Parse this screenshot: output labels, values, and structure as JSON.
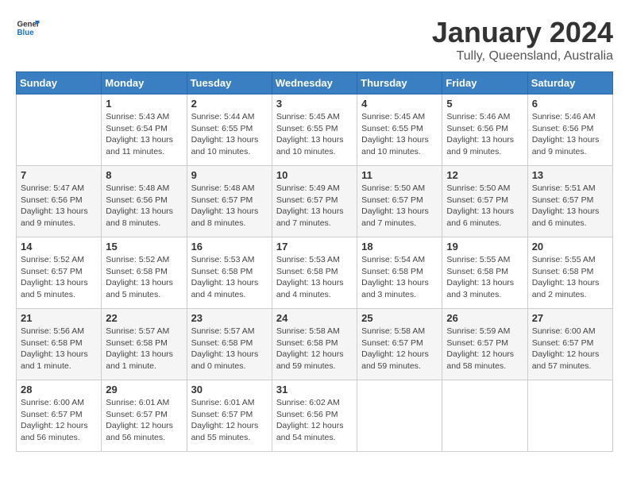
{
  "header": {
    "logo_general": "General",
    "logo_blue": "Blue",
    "month_title": "January 2024",
    "location": "Tully, Queensland, Australia"
  },
  "weekdays": [
    "Sunday",
    "Monday",
    "Tuesday",
    "Wednesday",
    "Thursday",
    "Friday",
    "Saturday"
  ],
  "weeks": [
    [
      {
        "day": "",
        "sunrise": "",
        "sunset": "",
        "daylight": ""
      },
      {
        "day": "1",
        "sunrise": "Sunrise: 5:43 AM",
        "sunset": "Sunset: 6:54 PM",
        "daylight": "Daylight: 13 hours and 11 minutes."
      },
      {
        "day": "2",
        "sunrise": "Sunrise: 5:44 AM",
        "sunset": "Sunset: 6:55 PM",
        "daylight": "Daylight: 13 hours and 10 minutes."
      },
      {
        "day": "3",
        "sunrise": "Sunrise: 5:45 AM",
        "sunset": "Sunset: 6:55 PM",
        "daylight": "Daylight: 13 hours and 10 minutes."
      },
      {
        "day": "4",
        "sunrise": "Sunrise: 5:45 AM",
        "sunset": "Sunset: 6:55 PM",
        "daylight": "Daylight: 13 hours and 10 minutes."
      },
      {
        "day": "5",
        "sunrise": "Sunrise: 5:46 AM",
        "sunset": "Sunset: 6:56 PM",
        "daylight": "Daylight: 13 hours and 9 minutes."
      },
      {
        "day": "6",
        "sunrise": "Sunrise: 5:46 AM",
        "sunset": "Sunset: 6:56 PM",
        "daylight": "Daylight: 13 hours and 9 minutes."
      }
    ],
    [
      {
        "day": "7",
        "sunrise": "Sunrise: 5:47 AM",
        "sunset": "Sunset: 6:56 PM",
        "daylight": "Daylight: 13 hours and 9 minutes."
      },
      {
        "day": "8",
        "sunrise": "Sunrise: 5:48 AM",
        "sunset": "Sunset: 6:56 PM",
        "daylight": "Daylight: 13 hours and 8 minutes."
      },
      {
        "day": "9",
        "sunrise": "Sunrise: 5:48 AM",
        "sunset": "Sunset: 6:57 PM",
        "daylight": "Daylight: 13 hours and 8 minutes."
      },
      {
        "day": "10",
        "sunrise": "Sunrise: 5:49 AM",
        "sunset": "Sunset: 6:57 PM",
        "daylight": "Daylight: 13 hours and 7 minutes."
      },
      {
        "day": "11",
        "sunrise": "Sunrise: 5:50 AM",
        "sunset": "Sunset: 6:57 PM",
        "daylight": "Daylight: 13 hours and 7 minutes."
      },
      {
        "day": "12",
        "sunrise": "Sunrise: 5:50 AM",
        "sunset": "Sunset: 6:57 PM",
        "daylight": "Daylight: 13 hours and 6 minutes."
      },
      {
        "day": "13",
        "sunrise": "Sunrise: 5:51 AM",
        "sunset": "Sunset: 6:57 PM",
        "daylight": "Daylight: 13 hours and 6 minutes."
      }
    ],
    [
      {
        "day": "14",
        "sunrise": "Sunrise: 5:52 AM",
        "sunset": "Sunset: 6:57 PM",
        "daylight": "Daylight: 13 hours and 5 minutes."
      },
      {
        "day": "15",
        "sunrise": "Sunrise: 5:52 AM",
        "sunset": "Sunset: 6:58 PM",
        "daylight": "Daylight: 13 hours and 5 minutes."
      },
      {
        "day": "16",
        "sunrise": "Sunrise: 5:53 AM",
        "sunset": "Sunset: 6:58 PM",
        "daylight": "Daylight: 13 hours and 4 minutes."
      },
      {
        "day": "17",
        "sunrise": "Sunrise: 5:53 AM",
        "sunset": "Sunset: 6:58 PM",
        "daylight": "Daylight: 13 hours and 4 minutes."
      },
      {
        "day": "18",
        "sunrise": "Sunrise: 5:54 AM",
        "sunset": "Sunset: 6:58 PM",
        "daylight": "Daylight: 13 hours and 3 minutes."
      },
      {
        "day": "19",
        "sunrise": "Sunrise: 5:55 AM",
        "sunset": "Sunset: 6:58 PM",
        "daylight": "Daylight: 13 hours and 3 minutes."
      },
      {
        "day": "20",
        "sunrise": "Sunrise: 5:55 AM",
        "sunset": "Sunset: 6:58 PM",
        "daylight": "Daylight: 13 hours and 2 minutes."
      }
    ],
    [
      {
        "day": "21",
        "sunrise": "Sunrise: 5:56 AM",
        "sunset": "Sunset: 6:58 PM",
        "daylight": "Daylight: 13 hours and 1 minute."
      },
      {
        "day": "22",
        "sunrise": "Sunrise: 5:57 AM",
        "sunset": "Sunset: 6:58 PM",
        "daylight": "Daylight: 13 hours and 1 minute."
      },
      {
        "day": "23",
        "sunrise": "Sunrise: 5:57 AM",
        "sunset": "Sunset: 6:58 PM",
        "daylight": "Daylight: 13 hours and 0 minutes."
      },
      {
        "day": "24",
        "sunrise": "Sunrise: 5:58 AM",
        "sunset": "Sunset: 6:58 PM",
        "daylight": "Daylight: 12 hours and 59 minutes."
      },
      {
        "day": "25",
        "sunrise": "Sunrise: 5:58 AM",
        "sunset": "Sunset: 6:57 PM",
        "daylight": "Daylight: 12 hours and 59 minutes."
      },
      {
        "day": "26",
        "sunrise": "Sunrise: 5:59 AM",
        "sunset": "Sunset: 6:57 PM",
        "daylight": "Daylight: 12 hours and 58 minutes."
      },
      {
        "day": "27",
        "sunrise": "Sunrise: 6:00 AM",
        "sunset": "Sunset: 6:57 PM",
        "daylight": "Daylight: 12 hours and 57 minutes."
      }
    ],
    [
      {
        "day": "28",
        "sunrise": "Sunrise: 6:00 AM",
        "sunset": "Sunset: 6:57 PM",
        "daylight": "Daylight: 12 hours and 56 minutes."
      },
      {
        "day": "29",
        "sunrise": "Sunrise: 6:01 AM",
        "sunset": "Sunset: 6:57 PM",
        "daylight": "Daylight: 12 hours and 56 minutes."
      },
      {
        "day": "30",
        "sunrise": "Sunrise: 6:01 AM",
        "sunset": "Sunset: 6:57 PM",
        "daylight": "Daylight: 12 hours and 55 minutes."
      },
      {
        "day": "31",
        "sunrise": "Sunrise: 6:02 AM",
        "sunset": "Sunset: 6:56 PM",
        "daylight": "Daylight: 12 hours and 54 minutes."
      },
      {
        "day": "",
        "sunrise": "",
        "sunset": "",
        "daylight": ""
      },
      {
        "day": "",
        "sunrise": "",
        "sunset": "",
        "daylight": ""
      },
      {
        "day": "",
        "sunrise": "",
        "sunset": "",
        "daylight": ""
      }
    ]
  ]
}
